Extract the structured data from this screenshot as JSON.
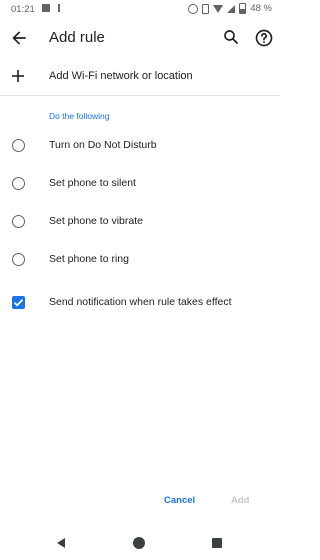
{
  "status_bar": {
    "time": "01:21",
    "battery_percent": "48 %",
    "icons": [
      "photo-icon",
      "download-icon",
      "alarm-icon",
      "vibrate-icon",
      "wifi-icon",
      "signal-icon",
      "battery-icon"
    ]
  },
  "app_bar": {
    "title": "Add rule",
    "icons": [
      "back-arrow-icon",
      "search-icon",
      "help-icon"
    ]
  },
  "add_location": {
    "label": "Add Wi-Fi network or location"
  },
  "section": {
    "header": "Do the following"
  },
  "options": [
    {
      "label": "Turn on Do Not Disturb",
      "selected": false
    },
    {
      "label": "Set phone to silent",
      "selected": false
    },
    {
      "label": "Set phone to vibrate",
      "selected": false
    },
    {
      "label": "Set phone to ring",
      "selected": false
    }
  ],
  "notification": {
    "label": "Send notification when rule takes effect",
    "checked": true
  },
  "actions": {
    "cancel": "Cancel",
    "add": "Add"
  },
  "colors": {
    "accent": "#1a73e8",
    "disabled": "#c8c8c8",
    "text": "#202124",
    "icon": "#5f6368"
  }
}
